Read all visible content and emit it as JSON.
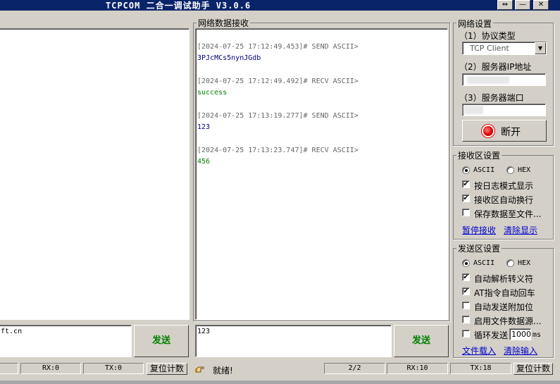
{
  "window": {
    "title": "TCPCOM 二合一调试助手  V3.0.6",
    "btn_pin": "⇔",
    "btn_min": "—",
    "btn_close": "✕"
  },
  "recv_panel": {
    "title": "网络数据接收",
    "log": [
      {
        "ts": "[2024-07-25 17:12:49.453]# SEND ASCII>",
        "content": "3PJcMCs5nynJGdb",
        "kind": "sent"
      },
      {
        "ts": "[2024-07-25 17:12:49.492]# RECV ASCII>",
        "content": "success",
        "kind": "recv"
      },
      {
        "ts": "[2024-07-25 17:13:19.277]# SEND ASCII>",
        "content": "123",
        "kind": "sent"
      },
      {
        "ts": "[2024-07-25 17:13:23.747]# RECV ASCII>",
        "content": "456",
        "kind": "recv"
      }
    ]
  },
  "left_send": {
    "partial_text": "ft.cn",
    "send_label": "发送"
  },
  "net_send": {
    "value": "123",
    "send_label": "发送"
  },
  "net_settings": {
    "title": "网络设置",
    "protocol_label": "（1）协议类型",
    "protocol_value": "TCP Client",
    "server_ip_label": "（2）服务器IP地址",
    "server_port_label": "（3）服务器端口",
    "disconnect_label": "断开"
  },
  "recv_settings": {
    "title": "接收区设置",
    "ascii": "ASCII",
    "hex": "HEX",
    "log_mode": "按日志模式显示",
    "auto_wrap": "接收区自动换行",
    "save_to_file": "保存数据至文件...",
    "pause_link": "暂停接收",
    "clear_link": "清除显示"
  },
  "send_settings": {
    "title": "发送区设置",
    "ascii": "ASCII",
    "hex": "HEX",
    "escape": "自动解析转义符",
    "at_cr": "AT指令自动回车",
    "append": "自动发送附加位",
    "file_source": "启用文件数据源...",
    "loop_send": "循环发送",
    "loop_ms_value": "1000",
    "ms_unit": "ms",
    "file_load_link": "文件载入",
    "clear_input_link": "清除输入"
  },
  "status": {
    "left_blank": "",
    "left_rx": "RX:0",
    "left_tx": "TX:0",
    "left_reset": "复位计数",
    "ready": "就绪!",
    "page": "2/2",
    "rx": "RX:10",
    "tx": "TX:18",
    "reset": "复位计数"
  }
}
